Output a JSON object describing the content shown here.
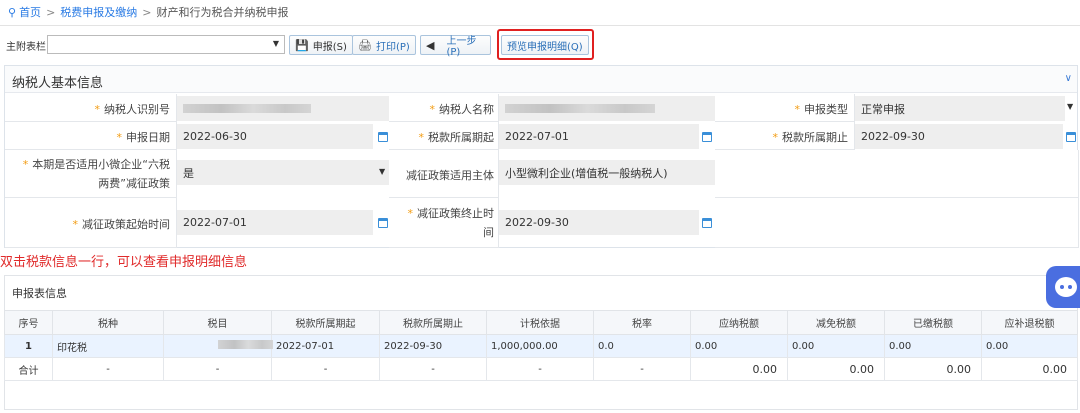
{
  "breadcrumb": {
    "home": "首页",
    "section": "税费申报及缴纳",
    "current": "财产和行为税合并纳税申报",
    "separator": ">"
  },
  "toolbar": {
    "main_form_label": "主附表栏:",
    "main_form_value": "",
    "declare_btn": "申报(S)",
    "print_btn": "打印(P)",
    "prev_btn": "上一步(P)",
    "preview_btn": "预览申报明细(Q)"
  },
  "taxpayer": {
    "section_title": "纳税人基本信息",
    "id_label": "纳税人识别号",
    "name_label": "纳税人名称",
    "decl_type_label": "申报类型",
    "decl_type_value": "正常申报",
    "decl_date_label": "申报日期",
    "decl_date_value": "2022-06-30",
    "period_start_label": "税款所属期起",
    "period_start_value": "2022-07-01",
    "period_end_label": "税款所属期止",
    "period_end_value": "2022-09-30",
    "policy_label_1": "本期是否适用小微企业“六税",
    "policy_label_2": "两费”减征政策",
    "policy_value": "是",
    "policy_subject_label": "减征政策适用主体",
    "policy_subject_value": "小型微利企业(增值税一般纳税人)",
    "policy_start_label": "减征政策起始时间",
    "policy_start_value": "2022-07-01",
    "policy_end_label_1": "减征政策终止时",
    "policy_end_label_2": "间",
    "policy_end_value": "2022-09-30"
  },
  "note": "双击税款信息一行，可以查看申报明细信息",
  "declaration": {
    "section_title": "申报表信息",
    "columns": [
      "序号",
      "税种",
      "税目",
      "税款所属期起",
      "税款所属期止",
      "计税依据",
      "税率",
      "应纳税额",
      "减免税额",
      "已缴税额",
      "应补退税额"
    ],
    "row": [
      "1",
      "印花税",
      "",
      "2022-07-01",
      "2022-09-30",
      "1,000,000.00",
      "0.0",
      "0.00",
      "0.00",
      "0.00",
      "0.00"
    ],
    "total": [
      "合计",
      "-",
      "-",
      "-",
      "-",
      "-",
      "-",
      "0.00",
      "0.00",
      "0.00",
      "0.00"
    ]
  },
  "colors": {
    "accent": "#2a7be4",
    "required_star": "#f39c12",
    "highlight_red": "#e02020"
  }
}
